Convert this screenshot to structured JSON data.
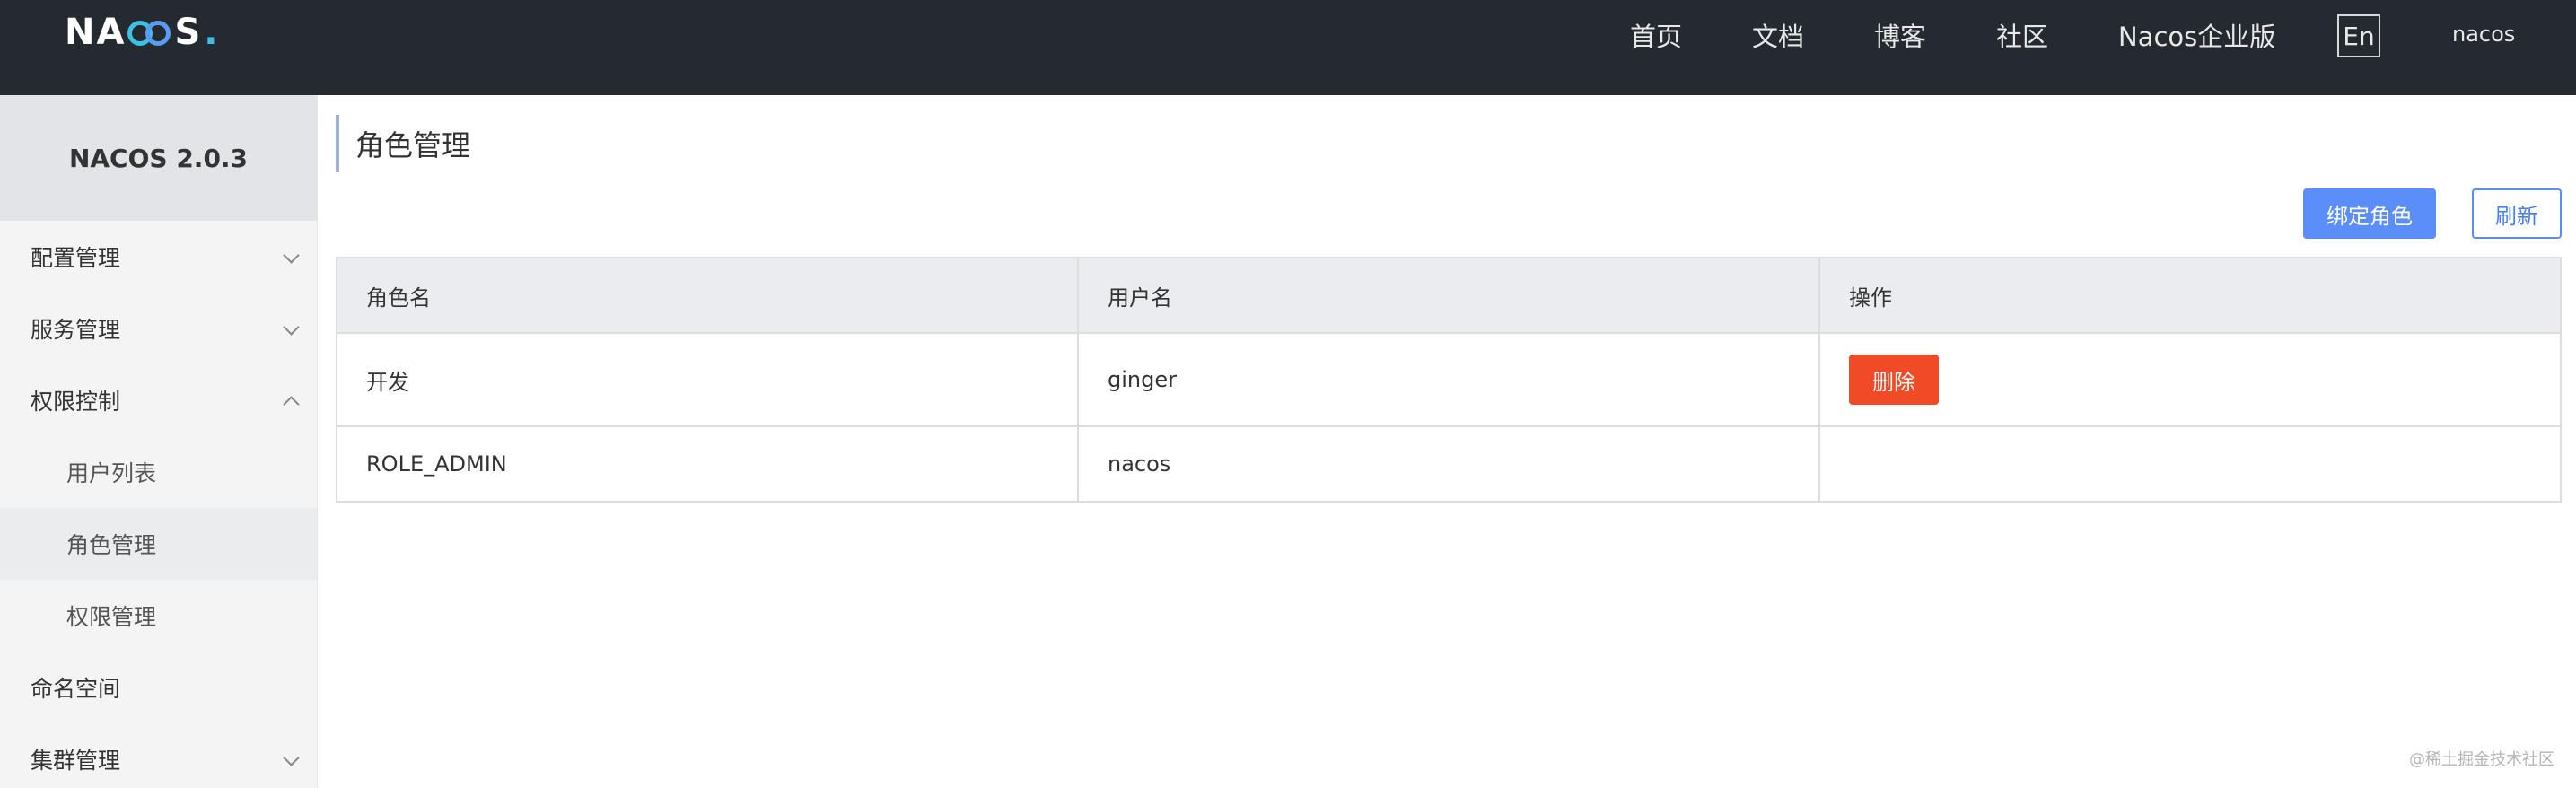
{
  "header": {
    "logo_text_left": "NA",
    "logo_text_right": "S",
    "logo_dot": ".",
    "nav": [
      "首页",
      "文档",
      "博客",
      "社区",
      "Nacos企业版"
    ],
    "lang_button": "En",
    "user": "nacos"
  },
  "sidebar": {
    "version": "NACOS 2.0.3",
    "items": [
      {
        "label": "配置管理",
        "expanded": false
      },
      {
        "label": "服务管理",
        "expanded": false
      },
      {
        "label": "权限控制",
        "expanded": true
      },
      {
        "label": "用户列表"
      },
      {
        "label": "角色管理",
        "active": true
      },
      {
        "label": "权限管理"
      },
      {
        "label": "命名空间"
      },
      {
        "label": "集群管理",
        "expanded": false
      }
    ]
  },
  "main": {
    "title": "角色管理",
    "bind_role_button": "绑定角色",
    "refresh_button": "刷新",
    "table": {
      "headers": [
        "角色名",
        "用户名",
        "操作"
      ],
      "rows": [
        {
          "role": "开发",
          "user": "ginger",
          "action": "删除"
        },
        {
          "role": "ROLE_ADMIN",
          "user": "nacos",
          "action": ""
        }
      ]
    }
  },
  "watermark": "@稀土掘金技术社区",
  "colors": {
    "topbar": "#252a31",
    "primary": "#5b8ef8",
    "danger": "#f04a26",
    "logo_accent": "#3cc1e6"
  }
}
